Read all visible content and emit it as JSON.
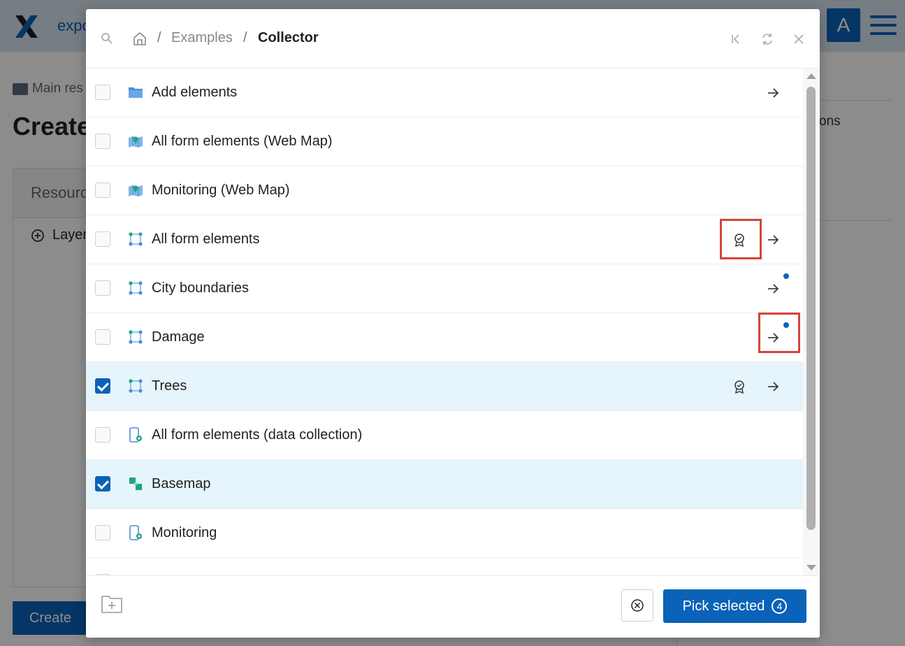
{
  "background": {
    "app_title": "expo",
    "avatar_letter": "A",
    "breadcrumb": "Main res",
    "page_title": "Create",
    "card_title": "Resourc",
    "layer_label": "Layer",
    "create_button": "Create",
    "right_text": "ons"
  },
  "modal": {
    "breadcrumb": {
      "items": [
        "Examples",
        "Collector"
      ],
      "separator": "/"
    },
    "header_buttons": [
      "first-page-icon",
      "refresh-icon",
      "close-icon"
    ],
    "rows": [
      {
        "label": "Add elements",
        "icon": "folder-icon",
        "checked": false,
        "has_arrow": true,
        "has_badge": false,
        "has_dot": false
      },
      {
        "label": "All form elements (Web Map)",
        "icon": "webmap-icon",
        "checked": false,
        "has_arrow": false,
        "has_badge": false,
        "has_dot": false
      },
      {
        "label": "Monitoring (Web Map)",
        "icon": "webmap-icon",
        "checked": false,
        "has_arrow": false,
        "has_badge": false,
        "has_dot": false
      },
      {
        "label": "All form elements",
        "icon": "vector-layer-icon",
        "checked": false,
        "has_arrow": true,
        "has_badge": true,
        "has_dot": false
      },
      {
        "label": "City boundaries",
        "icon": "vector-layer-icon",
        "checked": false,
        "has_arrow": true,
        "has_badge": false,
        "has_dot": true
      },
      {
        "label": "Damage",
        "icon": "vector-layer-icon",
        "checked": false,
        "has_arrow": true,
        "has_badge": false,
        "has_dot": true
      },
      {
        "label": "Trees",
        "icon": "vector-layer-icon",
        "checked": true,
        "has_arrow": true,
        "has_badge": true,
        "has_dot": false
      },
      {
        "label": "All form elements (data collection)",
        "icon": "collector-project-icon",
        "checked": false,
        "has_arrow": false,
        "has_badge": false,
        "has_dot": false
      },
      {
        "label": "Basemap",
        "icon": "basemap-icon",
        "checked": true,
        "has_arrow": false,
        "has_badge": false,
        "has_dot": false
      },
      {
        "label": "Monitoring",
        "icon": "collector-project-icon",
        "checked": false,
        "has_arrow": false,
        "has_badge": false,
        "has_dot": false
      }
    ],
    "footer": {
      "pick_label": "Pick selected",
      "pick_count": "4"
    }
  },
  "colors": {
    "accent": "#0a63b8",
    "selected_row": "#e6f4fb",
    "highlight": "#d2453a"
  }
}
